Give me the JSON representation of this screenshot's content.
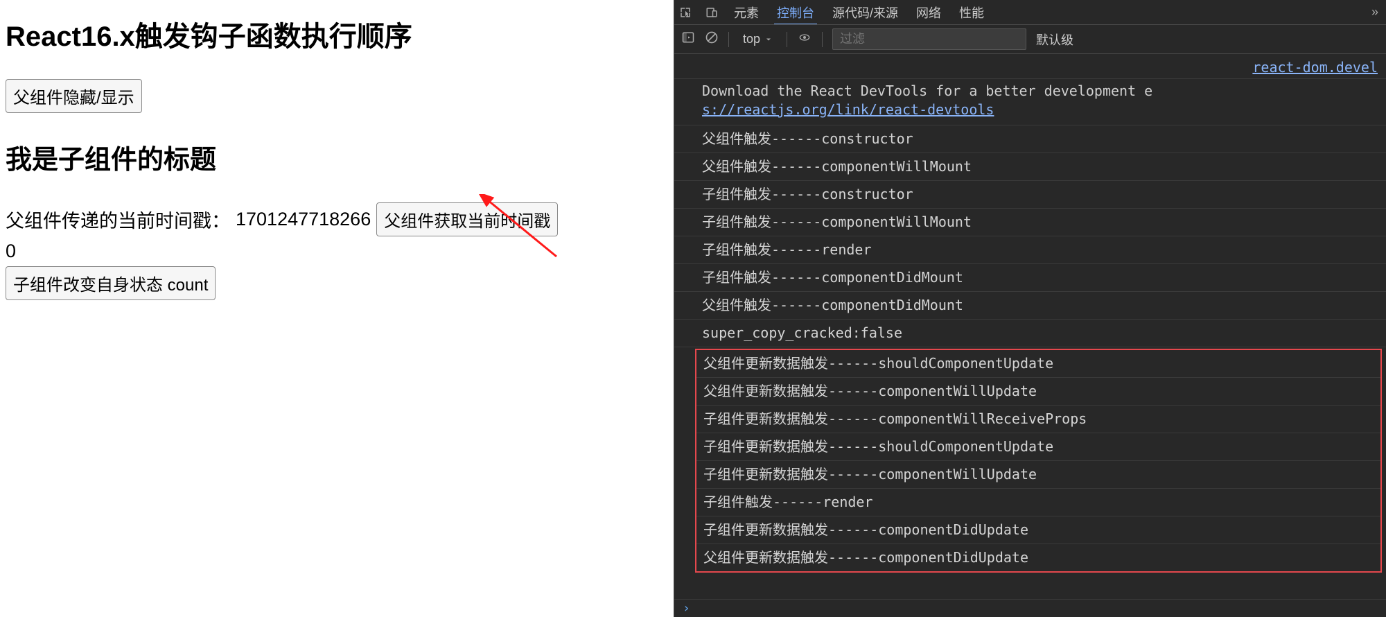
{
  "page": {
    "title": "React16.x触发钩子函数执行顺序",
    "toggle_button": "父组件隐藏/显示",
    "child_title": "我是子组件的标题",
    "timestamp_label": "父组件传递的当前时间戳：",
    "timestamp_value": "1701247718266",
    "get_time_button": "父组件获取当前时间戳",
    "count_value": "0",
    "change_count_button": "子组件改变自身状态 count"
  },
  "devtools": {
    "tabs": {
      "elements": "元素",
      "console": "控制台",
      "sources": "源代码/来源",
      "network": "网络",
      "performance": "性能"
    },
    "toolbar": {
      "context": "top",
      "filter_placeholder": "过滤",
      "level": "默认级"
    },
    "console": {
      "source_link": "react-dom.devel",
      "info_prefix": "Download the React DevTools for a better development e",
      "info_link": "s://reactjs.org/link/react-devtools",
      "logs": [
        "父组件触发------constructor",
        "父组件触发------componentWillMount",
        "子组件触发------constructor",
        "子组件触发------componentWillMount",
        "子组件触发------render",
        "子组件触发------componentDidMount",
        "父组件触发------componentDidMount",
        "super_copy_cracked:false"
      ],
      "update_logs": [
        "父组件更新数据触发------shouldComponentUpdate",
        "父组件更新数据触发------componentWillUpdate",
        "子组件更新数据触发------componentWillReceiveProps",
        "子组件更新数据触发------shouldComponentUpdate",
        "子组件更新数据触发------componentWillUpdate",
        "子组件触发------render",
        "子组件更新数据触发------componentDidUpdate",
        "父组件更新数据触发------componentDidUpdate"
      ]
    }
  }
}
